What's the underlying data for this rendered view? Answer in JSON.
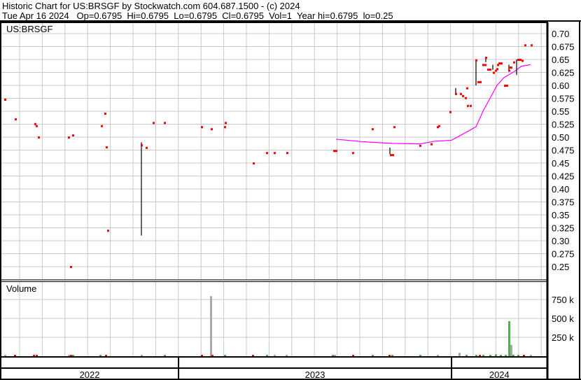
{
  "header": {
    "title": "Historic Chart for US:BRSGF by Stockwatch.com 604.687.1500 - (c) 2024",
    "quote": "Tue Apr 16 2024   Op=0.6795  Hi=0.6795  Lo=0.6795  Cl=0.6795  Vol=1  Year hi=0.6795  lo=0.25"
  },
  "chart_data": {
    "type": "scatter",
    "symbol": "US:BRSGF",
    "volume_label": "Volume",
    "x_unit": "fractional year",
    "xlim": [
      2022.346,
      2024.35
    ],
    "ylim": [
      0.225,
      0.715
    ],
    "y_ticks": [
      "0.70",
      "0.675",
      "0.65",
      "0.625",
      "0.60",
      "0.575",
      "0.55",
      "0.525",
      "0.50",
      "0.475",
      "0.45",
      "0.425",
      "0.40",
      "0.375",
      "0.35",
      "0.325",
      "0.30",
      "0.275",
      "0.25"
    ],
    "volume_ticks": [
      "750 k",
      "500 k",
      "250 k"
    ],
    "volume_tick_values": [
      750,
      500,
      250
    ],
    "x_labels": [
      {
        "label": "2022",
        "from": 2022.346,
        "to": 2023.0
      },
      {
        "label": "2023",
        "from": 2023.0,
        "to": 2024.0
      },
      {
        "label": "2024",
        "from": 2024.0,
        "to": 2024.35
      }
    ],
    "colors": {
      "price": "#ff0000",
      "range": "#000000",
      "ma": "#ff00ff",
      "vol_up": "#4caf50",
      "vol_down": "#ff0000",
      "vol_flat": "#a8a8a8"
    },
    "price_points": [
      [
        7,
        0.573
      ],
      [
        22,
        0.535
      ],
      [
        50,
        0.526
      ],
      [
        52,
        0.522
      ],
      [
        55,
        0.5
      ],
      [
        98,
        0.5
      ],
      [
        104,
        0.504
      ],
      [
        101,
        0.25
      ],
      [
        145,
        0.522
      ],
      [
        150,
        0.546
      ],
      [
        152,
        0.481
      ],
      [
        154,
        0.32
      ],
      [
        202,
        0.485
      ],
      [
        209,
        0.48
      ],
      [
        219,
        0.528
      ],
      [
        235,
        0.528
      ],
      [
        288,
        0.52
      ],
      [
        302,
        0.516
      ],
      [
        321,
        0.52
      ],
      [
        322,
        0.528
      ],
      [
        362,
        0.45
      ],
      [
        381,
        0.47
      ],
      [
        392,
        0.47
      ],
      [
        410,
        0.47
      ],
      [
        477,
        0.474
      ],
      [
        480,
        0.474
      ],
      [
        504,
        0.47
      ],
      [
        532,
        0.516
      ],
      [
        558,
        0.466
      ],
      [
        561,
        0.466
      ],
      [
        563,
        0.52
      ],
      [
        600,
        0.484
      ],
      [
        616,
        0.487
      ],
      [
        625,
        0.52
      ],
      [
        627,
        0.522
      ],
      [
        643,
        0.549
      ],
      [
        651,
        0.584
      ],
      [
        658,
        0.584
      ],
      [
        661,
        0.58
      ],
      [
        665,
        0.576
      ],
      [
        667,
        0.595
      ],
      [
        668,
        0.561
      ],
      [
        672,
        0.561
      ],
      [
        680,
        0.649
      ],
      [
        683,
        0.607
      ],
      [
        686,
        0.607
      ],
      [
        690,
        0.64
      ],
      [
        693,
        0.64
      ],
      [
        694,
        0.654
      ],
      [
        697,
        0.631
      ],
      [
        700,
        0.631
      ],
      [
        705,
        0.625
      ],
      [
        708,
        0.629
      ],
      [
        710,
        0.632
      ],
      [
        711,
        0.64
      ],
      [
        713,
        0.643
      ],
      [
        716,
        0.643
      ],
      [
        721,
        0.6
      ],
      [
        724,
        0.6
      ],
      [
        727,
        0.629
      ],
      [
        728,
        0.635
      ],
      [
        730,
        0.635
      ],
      [
        734,
        0.645
      ],
      [
        740,
        0.65
      ],
      [
        743,
        0.65
      ],
      [
        746,
        0.648
      ],
      [
        750,
        0.678
      ],
      [
        759,
        0.678
      ]
    ],
    "ranges": [
      [
        202,
        0.31,
        0.49
      ],
      [
        557,
        0.467,
        0.48
      ],
      [
        651,
        0.585,
        0.595
      ],
      [
        680,
        0.6,
        0.65
      ],
      [
        694,
        0.645,
        0.655
      ],
      [
        704,
        0.63,
        0.64
      ],
      [
        727,
        0.63,
        0.64
      ],
      [
        738,
        0.62,
        0.65
      ]
    ],
    "moving_average": [
      [
        480,
        0.496
      ],
      [
        520,
        0.491
      ],
      [
        560,
        0.488
      ],
      [
        600,
        0.487
      ],
      [
        620,
        0.492
      ],
      [
        645,
        0.494
      ],
      [
        660,
        0.505
      ],
      [
        680,
        0.52
      ],
      [
        690,
        0.55
      ],
      [
        700,
        0.575
      ],
      [
        710,
        0.6
      ],
      [
        720,
        0.615
      ],
      [
        735,
        0.627
      ],
      [
        745,
        0.637
      ],
      [
        758,
        0.64
      ]
    ],
    "volume": [
      [
        7,
        3,
        "flat"
      ],
      [
        21,
        4,
        "down"
      ],
      [
        48,
        8,
        "down"
      ],
      [
        52,
        6,
        "down"
      ],
      [
        98,
        10,
        "flat"
      ],
      [
        101,
        6,
        "down"
      ],
      [
        104,
        15,
        "up"
      ],
      [
        143,
        4,
        "up"
      ],
      [
        151,
        4,
        "down"
      ],
      [
        202,
        3,
        "flat"
      ],
      [
        235,
        3,
        "up"
      ],
      [
        288,
        6,
        "down"
      ],
      [
        301,
        795,
        "flat"
      ],
      [
        303,
        3,
        "down"
      ],
      [
        321,
        4,
        "up"
      ],
      [
        361,
        3,
        "down"
      ],
      [
        381,
        4,
        "up"
      ],
      [
        392,
        3,
        "flat"
      ],
      [
        409,
        3,
        "flat"
      ],
      [
        475,
        4,
        "up"
      ],
      [
        478,
        4,
        "flat"
      ],
      [
        504,
        4,
        "down"
      ],
      [
        532,
        3,
        "up"
      ],
      [
        556,
        4,
        "down"
      ],
      [
        560,
        4,
        "up"
      ],
      [
        600,
        4,
        "up"
      ],
      [
        625,
        3,
        "flat"
      ],
      [
        656,
        45,
        "flat"
      ],
      [
        666,
        6,
        "up"
      ],
      [
        680,
        15,
        "up"
      ],
      [
        685,
        10,
        "down"
      ],
      [
        690,
        15,
        "up"
      ],
      [
        700,
        12,
        "up"
      ],
      [
        708,
        25,
        "up"
      ],
      [
        715,
        10,
        "up"
      ],
      [
        722,
        12,
        "up"
      ],
      [
        727,
        463,
        "up"
      ],
      [
        730,
        150,
        "flat"
      ],
      [
        733,
        20,
        "up"
      ],
      [
        740,
        8,
        "up"
      ],
      [
        748,
        10,
        "down"
      ],
      [
        758,
        3,
        "flat"
      ]
    ]
  }
}
